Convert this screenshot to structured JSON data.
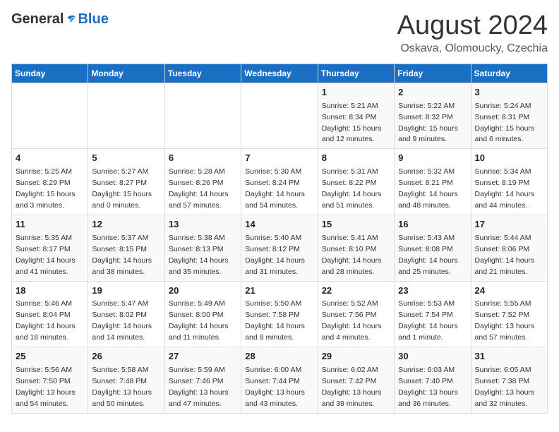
{
  "header": {
    "logo_general": "General",
    "logo_blue": "Blue",
    "month_year": "August 2024",
    "location": "Oskava, Olomoucky, Czechia"
  },
  "days_of_week": [
    "Sunday",
    "Monday",
    "Tuesday",
    "Wednesday",
    "Thursday",
    "Friday",
    "Saturday"
  ],
  "weeks": [
    [
      {
        "day": "",
        "info": ""
      },
      {
        "day": "",
        "info": ""
      },
      {
        "day": "",
        "info": ""
      },
      {
        "day": "",
        "info": ""
      },
      {
        "day": "1",
        "info": "Sunrise: 5:21 AM\nSunset: 8:34 PM\nDaylight: 15 hours\nand 12 minutes."
      },
      {
        "day": "2",
        "info": "Sunrise: 5:22 AM\nSunset: 8:32 PM\nDaylight: 15 hours\nand 9 minutes."
      },
      {
        "day": "3",
        "info": "Sunrise: 5:24 AM\nSunset: 8:31 PM\nDaylight: 15 hours\nand 6 minutes."
      }
    ],
    [
      {
        "day": "4",
        "info": "Sunrise: 5:25 AM\nSunset: 8:29 PM\nDaylight: 15 hours\nand 3 minutes."
      },
      {
        "day": "5",
        "info": "Sunrise: 5:27 AM\nSunset: 8:27 PM\nDaylight: 15 hours\nand 0 minutes."
      },
      {
        "day": "6",
        "info": "Sunrise: 5:28 AM\nSunset: 8:26 PM\nDaylight: 14 hours\nand 57 minutes."
      },
      {
        "day": "7",
        "info": "Sunrise: 5:30 AM\nSunset: 8:24 PM\nDaylight: 14 hours\nand 54 minutes."
      },
      {
        "day": "8",
        "info": "Sunrise: 5:31 AM\nSunset: 8:22 PM\nDaylight: 14 hours\nand 51 minutes."
      },
      {
        "day": "9",
        "info": "Sunrise: 5:32 AM\nSunset: 8:21 PM\nDaylight: 14 hours\nand 48 minutes."
      },
      {
        "day": "10",
        "info": "Sunrise: 5:34 AM\nSunset: 8:19 PM\nDaylight: 14 hours\nand 44 minutes."
      }
    ],
    [
      {
        "day": "11",
        "info": "Sunrise: 5:35 AM\nSunset: 8:17 PM\nDaylight: 14 hours\nand 41 minutes."
      },
      {
        "day": "12",
        "info": "Sunrise: 5:37 AM\nSunset: 8:15 PM\nDaylight: 14 hours\nand 38 minutes."
      },
      {
        "day": "13",
        "info": "Sunrise: 5:38 AM\nSunset: 8:13 PM\nDaylight: 14 hours\nand 35 minutes."
      },
      {
        "day": "14",
        "info": "Sunrise: 5:40 AM\nSunset: 8:12 PM\nDaylight: 14 hours\nand 31 minutes."
      },
      {
        "day": "15",
        "info": "Sunrise: 5:41 AM\nSunset: 8:10 PM\nDaylight: 14 hours\nand 28 minutes."
      },
      {
        "day": "16",
        "info": "Sunrise: 5:43 AM\nSunset: 8:08 PM\nDaylight: 14 hours\nand 25 minutes."
      },
      {
        "day": "17",
        "info": "Sunrise: 5:44 AM\nSunset: 8:06 PM\nDaylight: 14 hours\nand 21 minutes."
      }
    ],
    [
      {
        "day": "18",
        "info": "Sunrise: 5:46 AM\nSunset: 8:04 PM\nDaylight: 14 hours\nand 18 minutes."
      },
      {
        "day": "19",
        "info": "Sunrise: 5:47 AM\nSunset: 8:02 PM\nDaylight: 14 hours\nand 14 minutes."
      },
      {
        "day": "20",
        "info": "Sunrise: 5:49 AM\nSunset: 8:00 PM\nDaylight: 14 hours\nand 11 minutes."
      },
      {
        "day": "21",
        "info": "Sunrise: 5:50 AM\nSunset: 7:58 PM\nDaylight: 14 hours\nand 8 minutes."
      },
      {
        "day": "22",
        "info": "Sunrise: 5:52 AM\nSunset: 7:56 PM\nDaylight: 14 hours\nand 4 minutes."
      },
      {
        "day": "23",
        "info": "Sunrise: 5:53 AM\nSunset: 7:54 PM\nDaylight: 14 hours\nand 1 minute."
      },
      {
        "day": "24",
        "info": "Sunrise: 5:55 AM\nSunset: 7:52 PM\nDaylight: 13 hours\nand 57 minutes."
      }
    ],
    [
      {
        "day": "25",
        "info": "Sunrise: 5:56 AM\nSunset: 7:50 PM\nDaylight: 13 hours\nand 54 minutes."
      },
      {
        "day": "26",
        "info": "Sunrise: 5:58 AM\nSunset: 7:48 PM\nDaylight: 13 hours\nand 50 minutes."
      },
      {
        "day": "27",
        "info": "Sunrise: 5:59 AM\nSunset: 7:46 PM\nDaylight: 13 hours\nand 47 minutes."
      },
      {
        "day": "28",
        "info": "Sunrise: 6:00 AM\nSunset: 7:44 PM\nDaylight: 13 hours\nand 43 minutes."
      },
      {
        "day": "29",
        "info": "Sunrise: 6:02 AM\nSunset: 7:42 PM\nDaylight: 13 hours\nand 39 minutes."
      },
      {
        "day": "30",
        "info": "Sunrise: 6:03 AM\nSunset: 7:40 PM\nDaylight: 13 hours\nand 36 minutes."
      },
      {
        "day": "31",
        "info": "Sunrise: 6:05 AM\nSunset: 7:38 PM\nDaylight: 13 hours\nand 32 minutes."
      }
    ]
  ]
}
